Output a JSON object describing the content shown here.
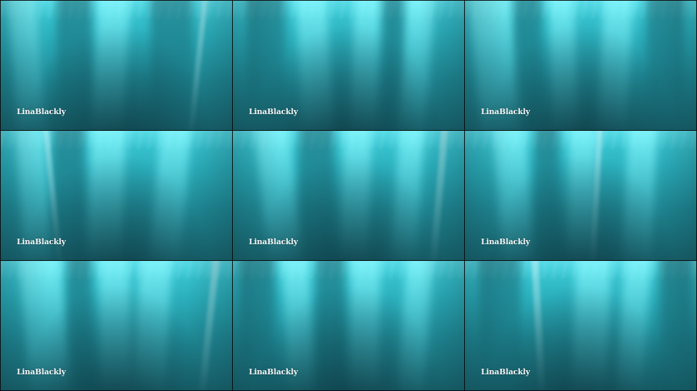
{
  "layout": "3x3 contact sheet of underwater sunbeam video frames",
  "colors": {
    "water_top": "#3fd0dc",
    "water_mid": "#1f8995",
    "water_bottom": "#17616b",
    "ray_light": "#8cfaff",
    "divider": "#0a0a0a",
    "watermark": "#f4f7f7"
  },
  "frames": [
    {
      "watermark": "LinaBlackly"
    },
    {
      "watermark": "LinaBlackly"
    },
    {
      "watermark": "LinaBlackly"
    },
    {
      "watermark": "LinaBlackly"
    },
    {
      "watermark": "LinaBlackly"
    },
    {
      "watermark": "LinaBlackly"
    },
    {
      "watermark": "LinaBlackly"
    },
    {
      "watermark": "LinaBlackly"
    },
    {
      "watermark": "LinaBlackly"
    }
  ]
}
